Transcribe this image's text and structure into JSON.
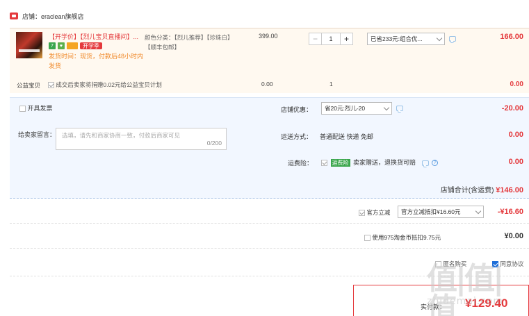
{
  "shop": {
    "label": "店铺：eraclean旗舰店"
  },
  "item": {
    "title": "【开学价】【烈儿宝贝直播间】...",
    "badges": {
      "seven": "7",
      "green": "♥",
      "card": "",
      "sale": "开学季"
    },
    "ship_time": "发货时间：现货，付款后48小时内发货",
    "sku": "颜色分类：【烈儿推荐】【珍珠白】【顺丰包邮】",
    "price": "399.00",
    "qty": "1",
    "qty_minus": "−",
    "qty_plus": "+",
    "promo_select": "已省233元:组合优...",
    "total": "166.00"
  },
  "charity": {
    "label": "公益宝贝",
    "desc": "成交后卖家将捐赠0.02元给公益宝贝计划",
    "price": "0.00",
    "qty": "1",
    "total": "0.00"
  },
  "options": {
    "invoice_label": "开具发票",
    "message_label": "给卖家留言：",
    "message_placeholder": "选填，请先和商家协商一致，付款后商家可见",
    "message_count": "0/200",
    "shop_discount_label": "店铺优惠：",
    "shop_discount_select": "省20元:烈儿-20",
    "shop_discount_amount": "-20.00",
    "delivery_label": "运送方式：",
    "delivery_value": "普通配送 快递 免邮",
    "delivery_amount": "0.00",
    "insurance_label": "运费险：",
    "insurance_tag": "运费险",
    "insurance_text": "卖家赠送，退换货可赔",
    "insurance_amount": "0.00",
    "shop_total_label": "店铺合计(含运费)",
    "shop_total_amount": "¥146.00"
  },
  "official_discount": {
    "label": "官方立减",
    "select": "官方立减抵扣¥16.60元",
    "amount": "-¥16.60"
  },
  "coin": {
    "label": "使用975淘金币抵扣9.75元",
    "amount": "¥0.00"
  },
  "pay_options": {
    "opt1": "匿名购买",
    "opt2": "同意协议"
  },
  "summary": {
    "label": "实付款：",
    "amount": "¥129.40"
  },
  "watermark": {
    "glyphs": "值|值|值",
    "text": "zhidemai.com"
  },
  "colors": {
    "accent": "#e4393c",
    "warm_bg": "#fff9f0",
    "blue_bg": "#f2f7ff"
  }
}
